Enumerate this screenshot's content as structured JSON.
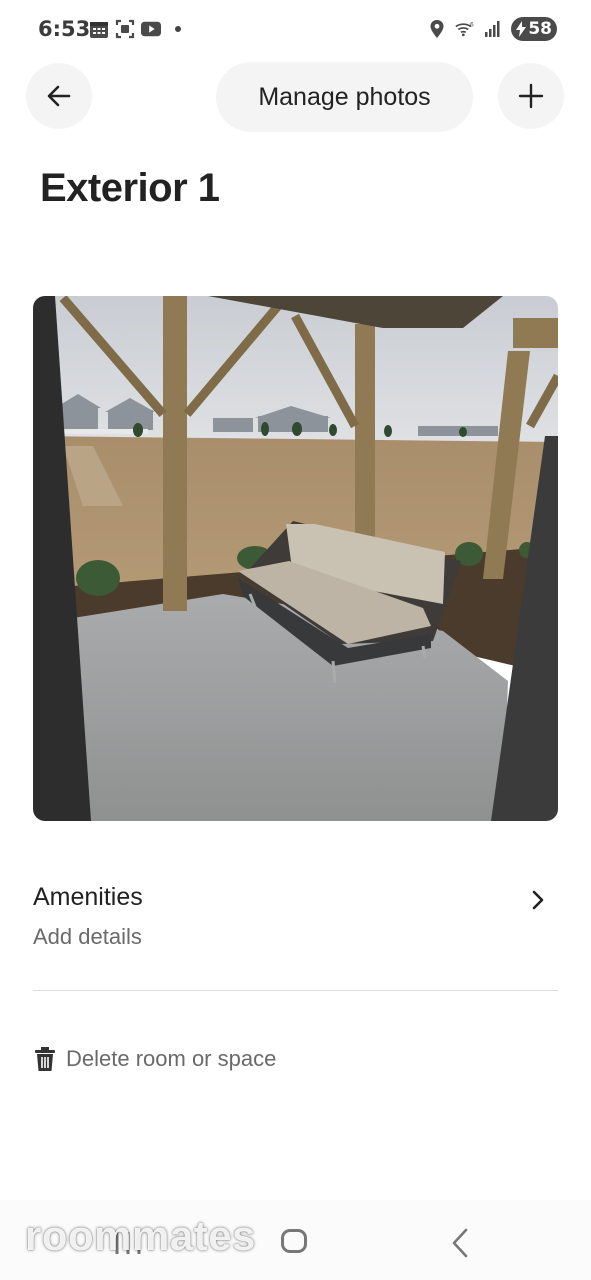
{
  "status_bar": {
    "time": "6:53",
    "battery": "58",
    "left_icons": [
      "calendar-icon",
      "screenshot-icon",
      "youtube-icon",
      "notification-dot"
    ],
    "right_icons": [
      "location-icon",
      "wifi-6-icon",
      "signal-icon",
      "battery-charging-icon"
    ]
  },
  "header": {
    "back_icon": "arrow-left-icon",
    "manage_photos_label": "Manage photos",
    "add_icon": "plus-icon"
  },
  "page": {
    "title": "Exterior 1"
  },
  "photo": {
    "description_icon": "room-photo"
  },
  "amenities": {
    "label": "Amenities",
    "sublabel": "Add details",
    "chevron_icon": "chevron-right-icon"
  },
  "delete": {
    "label": "Delete room or space",
    "icon": "trash-icon"
  },
  "watermark": {
    "text": "roommates"
  },
  "nav_bar": {
    "recents_icon": "recents-icon",
    "home_icon": "home-icon",
    "back_icon": "back-chevron-icon"
  },
  "colors": {
    "text_primary": "#222222",
    "text_secondary": "#6a6a6a",
    "button_bg": "#f4f4f4",
    "divider": "#dddddd"
  }
}
